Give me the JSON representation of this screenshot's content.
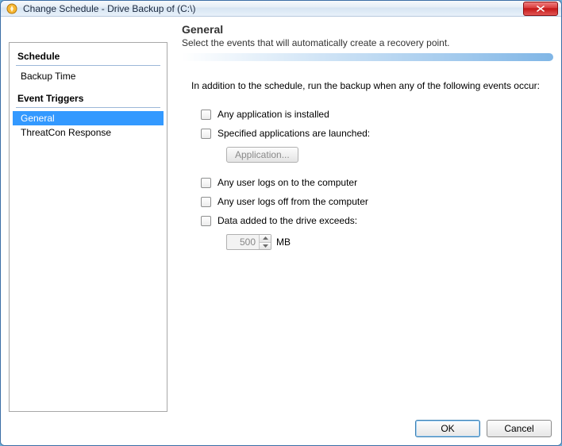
{
  "window": {
    "title": "Change Schedule - Drive Backup of  (C:\\)"
  },
  "sidebar": {
    "sections": [
      {
        "heading": "Schedule",
        "items": [
          {
            "label": "Backup Time",
            "selected": false
          }
        ]
      },
      {
        "heading": "Event Triggers",
        "items": [
          {
            "label": "General",
            "selected": true
          },
          {
            "label": "ThreatCon Response",
            "selected": false
          }
        ]
      }
    ]
  },
  "panel": {
    "title": "General",
    "subtitle": "Select the events that will automatically create a recovery point.",
    "intro": "In addition to the schedule, run the backup when any of the following events occur:",
    "options": {
      "app_installed": "Any application is installed",
      "apps_launched": "Specified applications are launched:",
      "application_button": "Application...",
      "logon": "Any user logs on to the computer",
      "logoff": "Any user logs off from the computer",
      "data_exceeds": "Data added to the drive exceeds:",
      "data_value": "500",
      "data_unit": "MB"
    }
  },
  "footer": {
    "ok": "OK",
    "cancel": "Cancel"
  }
}
